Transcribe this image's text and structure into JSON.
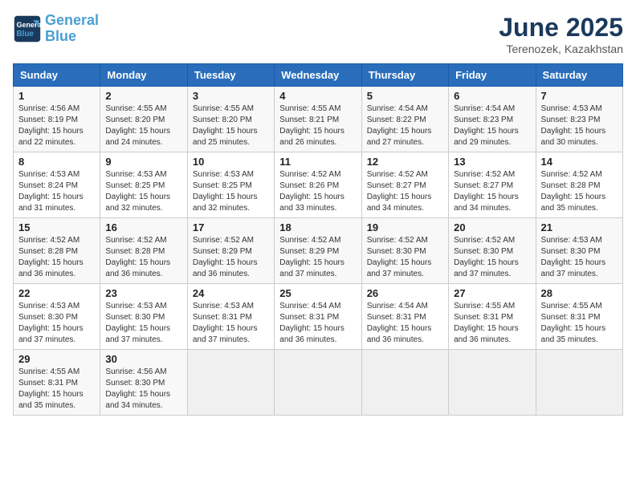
{
  "header": {
    "logo_line1": "General",
    "logo_line2": "Blue",
    "month_title": "June 2025",
    "location": "Terenozek, Kazakhstan"
  },
  "days_of_week": [
    "Sunday",
    "Monday",
    "Tuesday",
    "Wednesday",
    "Thursday",
    "Friday",
    "Saturday"
  ],
  "weeks": [
    [
      {
        "day": 1,
        "sunrise": "4:56 AM",
        "sunset": "8:19 PM",
        "daylight": "15 hours and 22 minutes."
      },
      {
        "day": 2,
        "sunrise": "4:55 AM",
        "sunset": "8:20 PM",
        "daylight": "15 hours and 24 minutes."
      },
      {
        "day": 3,
        "sunrise": "4:55 AM",
        "sunset": "8:20 PM",
        "daylight": "15 hours and 25 minutes."
      },
      {
        "day": 4,
        "sunrise": "4:55 AM",
        "sunset": "8:21 PM",
        "daylight": "15 hours and 26 minutes."
      },
      {
        "day": 5,
        "sunrise": "4:54 AM",
        "sunset": "8:22 PM",
        "daylight": "15 hours and 27 minutes."
      },
      {
        "day": 6,
        "sunrise": "4:54 AM",
        "sunset": "8:23 PM",
        "daylight": "15 hours and 29 minutes."
      },
      {
        "day": 7,
        "sunrise": "4:53 AM",
        "sunset": "8:23 PM",
        "daylight": "15 hours and 30 minutes."
      }
    ],
    [
      {
        "day": 8,
        "sunrise": "4:53 AM",
        "sunset": "8:24 PM",
        "daylight": "15 hours and 31 minutes."
      },
      {
        "day": 9,
        "sunrise": "4:53 AM",
        "sunset": "8:25 PM",
        "daylight": "15 hours and 32 minutes."
      },
      {
        "day": 10,
        "sunrise": "4:53 AM",
        "sunset": "8:25 PM",
        "daylight": "15 hours and 32 minutes."
      },
      {
        "day": 11,
        "sunrise": "4:52 AM",
        "sunset": "8:26 PM",
        "daylight": "15 hours and 33 minutes."
      },
      {
        "day": 12,
        "sunrise": "4:52 AM",
        "sunset": "8:27 PM",
        "daylight": "15 hours and 34 minutes."
      },
      {
        "day": 13,
        "sunrise": "4:52 AM",
        "sunset": "8:27 PM",
        "daylight": "15 hours and 34 minutes."
      },
      {
        "day": 14,
        "sunrise": "4:52 AM",
        "sunset": "8:28 PM",
        "daylight": "15 hours and 35 minutes."
      }
    ],
    [
      {
        "day": 15,
        "sunrise": "4:52 AM",
        "sunset": "8:28 PM",
        "daylight": "15 hours and 36 minutes."
      },
      {
        "day": 16,
        "sunrise": "4:52 AM",
        "sunset": "8:28 PM",
        "daylight": "15 hours and 36 minutes."
      },
      {
        "day": 17,
        "sunrise": "4:52 AM",
        "sunset": "8:29 PM",
        "daylight": "15 hours and 36 minutes."
      },
      {
        "day": 18,
        "sunrise": "4:52 AM",
        "sunset": "8:29 PM",
        "daylight": "15 hours and 37 minutes."
      },
      {
        "day": 19,
        "sunrise": "4:52 AM",
        "sunset": "8:30 PM",
        "daylight": "15 hours and 37 minutes."
      },
      {
        "day": 20,
        "sunrise": "4:52 AM",
        "sunset": "8:30 PM",
        "daylight": "15 hours and 37 minutes."
      },
      {
        "day": 21,
        "sunrise": "4:53 AM",
        "sunset": "8:30 PM",
        "daylight": "15 hours and 37 minutes."
      }
    ],
    [
      {
        "day": 22,
        "sunrise": "4:53 AM",
        "sunset": "8:30 PM",
        "daylight": "15 hours and 37 minutes."
      },
      {
        "day": 23,
        "sunrise": "4:53 AM",
        "sunset": "8:30 PM",
        "daylight": "15 hours and 37 minutes."
      },
      {
        "day": 24,
        "sunrise": "4:53 AM",
        "sunset": "8:31 PM",
        "daylight": "15 hours and 37 minutes."
      },
      {
        "day": 25,
        "sunrise": "4:54 AM",
        "sunset": "8:31 PM",
        "daylight": "15 hours and 36 minutes."
      },
      {
        "day": 26,
        "sunrise": "4:54 AM",
        "sunset": "8:31 PM",
        "daylight": "15 hours and 36 minutes."
      },
      {
        "day": 27,
        "sunrise": "4:55 AM",
        "sunset": "8:31 PM",
        "daylight": "15 hours and 36 minutes."
      },
      {
        "day": 28,
        "sunrise": "4:55 AM",
        "sunset": "8:31 PM",
        "daylight": "15 hours and 35 minutes."
      }
    ],
    [
      {
        "day": 29,
        "sunrise": "4:55 AM",
        "sunset": "8:31 PM",
        "daylight": "15 hours and 35 minutes."
      },
      {
        "day": 30,
        "sunrise": "4:56 AM",
        "sunset": "8:30 PM",
        "daylight": "15 hours and 34 minutes."
      },
      null,
      null,
      null,
      null,
      null
    ]
  ]
}
